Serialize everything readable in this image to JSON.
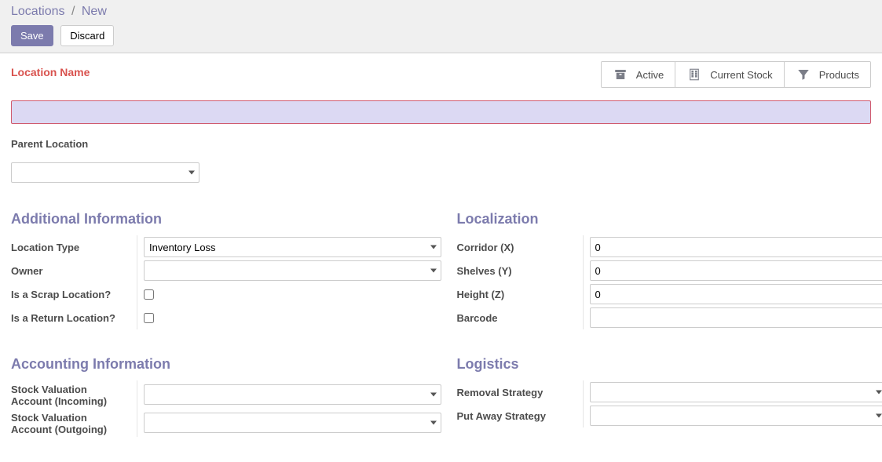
{
  "breadcrumb": {
    "root": "Locations",
    "current": "New",
    "sep": "/"
  },
  "buttons": {
    "save": "Save",
    "discard": "Discard"
  },
  "location_name": {
    "label": "Location Name",
    "value": ""
  },
  "stat_buttons": {
    "active": "Active",
    "current_stock": "Current Stock",
    "products": "Products"
  },
  "parent_location": {
    "label": "Parent Location",
    "value": ""
  },
  "sections": {
    "additional": {
      "title": "Additional Information",
      "location_type": {
        "label": "Location Type",
        "value": "Inventory Loss"
      },
      "owner": {
        "label": "Owner",
        "value": ""
      },
      "is_scrap": {
        "label": "Is a Scrap Location?",
        "checked": false
      },
      "is_return": {
        "label": "Is a Return Location?",
        "checked": false
      }
    },
    "localization": {
      "title": "Localization",
      "corridor": {
        "label": "Corridor (X)",
        "value": "0"
      },
      "shelves": {
        "label": "Shelves (Y)",
        "value": "0"
      },
      "height": {
        "label": "Height (Z)",
        "value": "0"
      },
      "barcode": {
        "label": "Barcode",
        "value": ""
      }
    },
    "accounting": {
      "title": "Accounting Information",
      "stock_in": {
        "label_line1": "Stock Valuation",
        "label_line2": "Account (Incoming)",
        "value": ""
      },
      "stock_out": {
        "label_line1": "Stock Valuation",
        "label_line2": "Account (Outgoing)",
        "value": ""
      }
    },
    "logistics": {
      "title": "Logistics",
      "removal": {
        "label": "Removal Strategy",
        "value": ""
      },
      "putaway": {
        "label": "Put Away Strategy",
        "value": ""
      }
    }
  }
}
